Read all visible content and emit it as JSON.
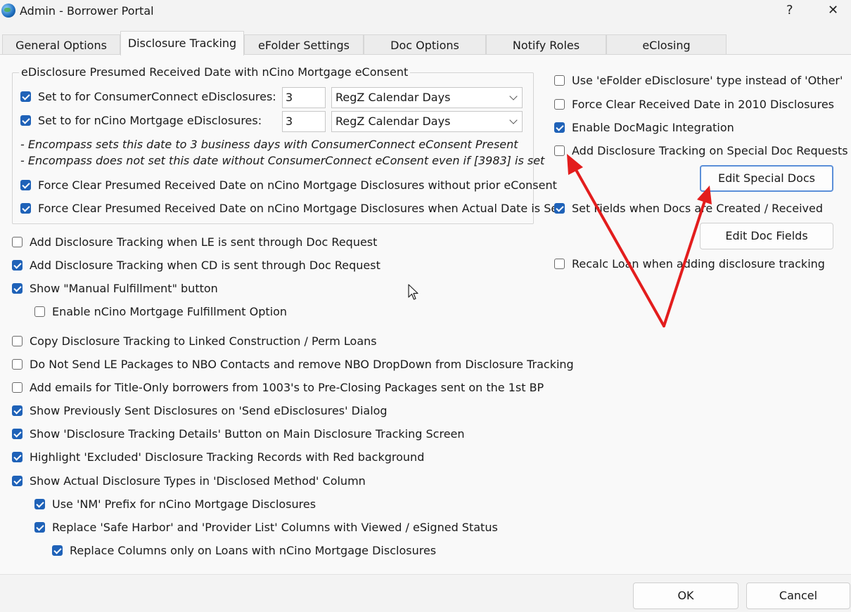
{
  "window": {
    "title": "Admin - Borrower Portal",
    "help_glyph": "?",
    "close_glyph": "✕"
  },
  "tabs": [
    {
      "label": "General Options"
    },
    {
      "label": "Disclosure Tracking"
    },
    {
      "label": "eFolder Settings"
    },
    {
      "label": "Doc Options"
    },
    {
      "label": "Notify Roles"
    },
    {
      "label": "eClosing"
    }
  ],
  "group": {
    "legend": "eDisclosure Presumed Received Date with nCino Mortgage eConsent",
    "row1": {
      "label": "Set to for ConsumerConnect eDisclosures:",
      "checked": true,
      "days": "3",
      "unit": "RegZ Calendar Days"
    },
    "row2": {
      "label": "Set to for nCino Mortgage eDisclosures:",
      "checked": true,
      "days": "3",
      "unit": "RegZ Calendar Days"
    },
    "note1": "- Encompass sets this date to 3 business days with ConsumerConnect eConsent Present",
    "note2": "- Encompass does not set this date without ConsumerConnect eConsent even if [3983] is set",
    "force1": {
      "label": "Force Clear Presumed Received Date on nCino Mortgage Disclosures without prior eConsent",
      "checked": true
    },
    "force2": {
      "label": "Force Clear Presumed Received Date on nCino Mortgage Disclosures when Actual Date is Set",
      "checked": true
    }
  },
  "left_options": [
    {
      "label": "Add Disclosure Tracking when LE is sent through Doc Request",
      "checked": false
    },
    {
      "label": "Add Disclosure Tracking when CD is sent through Doc Request",
      "checked": true
    },
    {
      "label": "Show \"Manual Fulfillment\" button",
      "checked": true
    },
    {
      "label": "Enable nCino Mortgage Fulfillment Option",
      "checked": false
    },
    {
      "label": "Copy Disclosure Tracking to Linked Construction / Perm Loans",
      "checked": false
    },
    {
      "label": "Do Not Send LE Packages to NBO Contacts and remove NBO DropDown from Disclosure Tracking",
      "checked": false
    },
    {
      "label": "Add emails for Title-Only borrowers from 1003's to Pre-Closing Packages sent on the 1st BP",
      "checked": false
    },
    {
      "label": "Show Previously Sent Disclosures on 'Send eDisclosures' Dialog",
      "checked": true
    },
    {
      "label": "Show 'Disclosure Tracking Details' Button on Main Disclosure Tracking Screen",
      "checked": true
    },
    {
      "label": "Highlight 'Excluded' Disclosure Tracking Records with Red background",
      "checked": true
    },
    {
      "label": "Show Actual Disclosure Types in 'Disclosed Method' Column",
      "checked": true
    },
    {
      "label": "Use 'NM' Prefix for nCino Mortgage Disclosures",
      "checked": true
    },
    {
      "label": "Replace 'Safe Harbor' and 'Provider List' Columns with Viewed / eSigned Status",
      "checked": true
    },
    {
      "label": "Replace Columns only on Loans with nCino Mortgage Disclosures",
      "checked": true
    }
  ],
  "right_options": [
    {
      "label": "Use 'eFolder eDisclosure' type instead of 'Other'",
      "checked": false
    },
    {
      "label": "Force Clear Received Date in 2010 Disclosures",
      "checked": false
    },
    {
      "label": "Enable DocMagic Integration",
      "checked": true
    },
    {
      "label": "Add Disclosure Tracking on Special Doc Requests",
      "checked": false
    },
    {
      "label": "Set Fields when Docs are Created / Received",
      "checked": true
    },
    {
      "label": "Recalc Loan when adding disclosure tracking",
      "checked": false
    }
  ],
  "buttons": {
    "edit_special_docs": "Edit Special Docs",
    "edit_doc_fields": "Edit Doc Fields",
    "ok": "OK",
    "cancel": "Cancel"
  },
  "colors": {
    "checkbox_checked": "#1f62b8",
    "annotation_arrow": "#e31d1d",
    "default_button_border": "#5b8fd8"
  }
}
